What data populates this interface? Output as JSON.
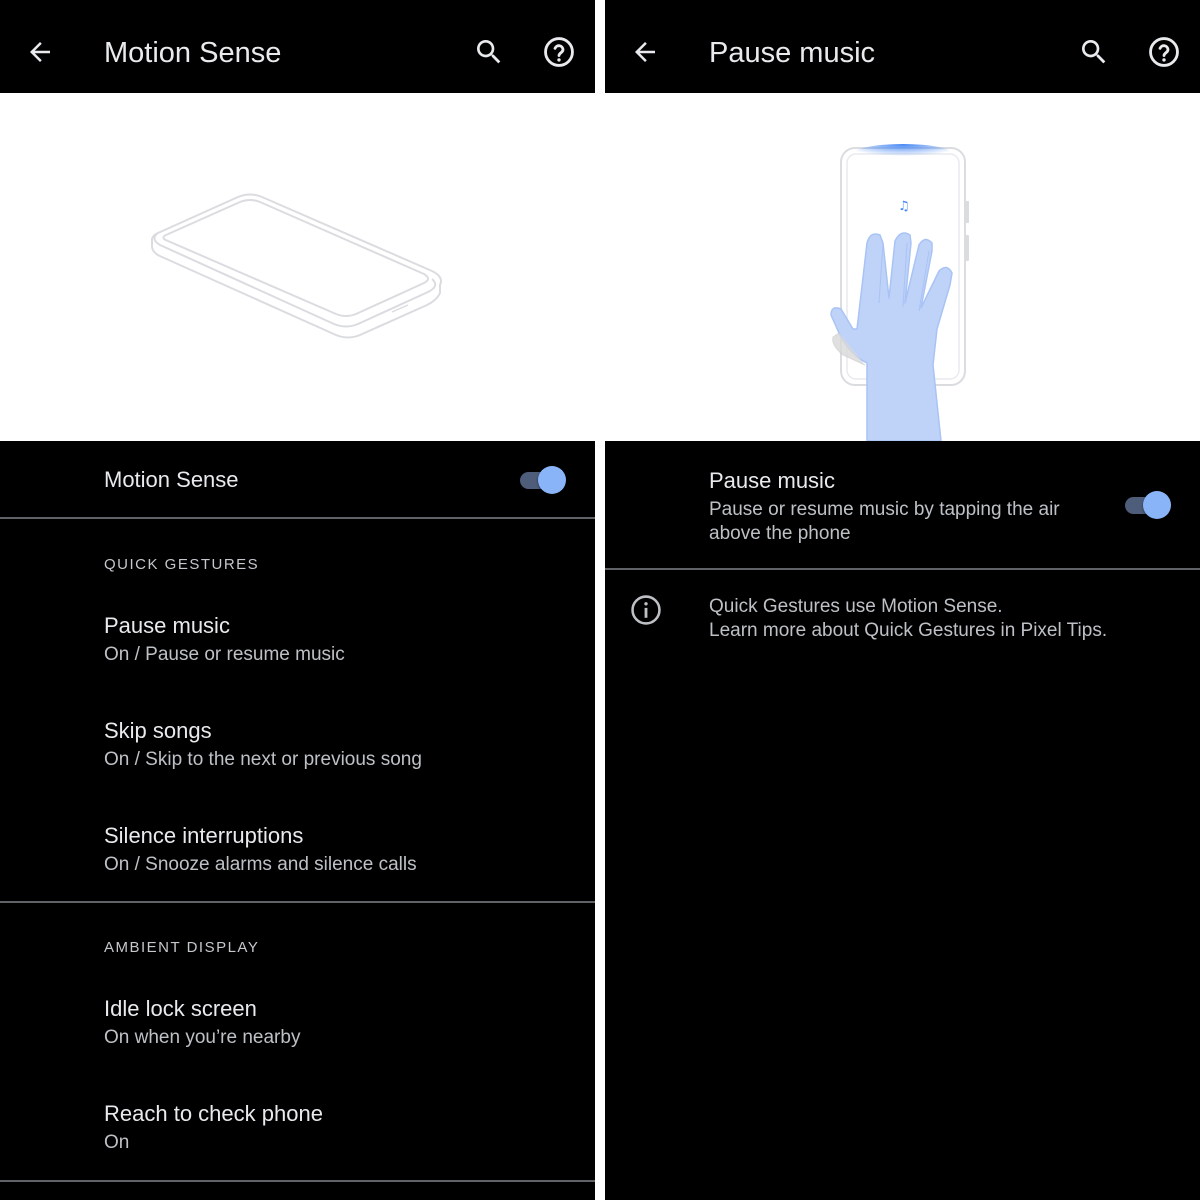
{
  "left_screen": {
    "title": "Motion Sense",
    "master_toggle": {
      "label": "Motion Sense",
      "on": true
    },
    "sections": [
      {
        "header": "QUICK GESTURES",
        "items": [
          {
            "title": "Pause music",
            "summary": "On / Pause or resume music"
          },
          {
            "title": "Skip songs",
            "summary": "On / Skip to the next or previous song"
          },
          {
            "title": "Silence interruptions",
            "summary": "On / Snooze alarms and silence calls"
          }
        ]
      },
      {
        "header": "AMBIENT DISPLAY",
        "items": [
          {
            "title": "Idle lock screen",
            "summary": "On when you’re nearby"
          },
          {
            "title": "Reach to check phone",
            "summary": "On"
          }
        ]
      }
    ]
  },
  "right_screen": {
    "title": "Pause music",
    "setting": {
      "title": "Pause music",
      "summary_line1": "Pause or resume music by tapping the air",
      "summary_line2": "above the phone",
      "on": true
    },
    "info": {
      "line1": "Quick Gestures use Motion Sense.",
      "line2": "Learn more about Quick Gestures in Pixel Tips."
    }
  },
  "icons": {
    "back": "arrow-back-icon",
    "search": "search-icon",
    "help": "help-icon",
    "info": "info-icon",
    "music_note": "music-note-icon"
  },
  "colors": {
    "background": "#000000",
    "text_primary": "#e8eaed",
    "text_secondary": "#bdc1c6",
    "accent": "#8ab4f8",
    "divider": "#5f6368"
  }
}
